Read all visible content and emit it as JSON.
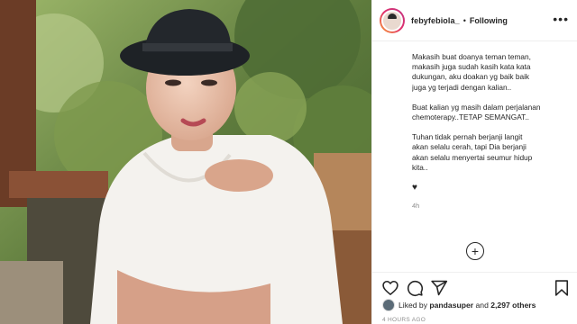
{
  "post": {
    "username": "febyfebiola_",
    "separator": "•",
    "follow_state": "Following",
    "more_label": "•••"
  },
  "caption": {
    "cut_line": "~~~~~ ~~~~~~~~ ~~~~~~~~~ ~~ ~~~~~~",
    "paragraph_1": "Makasih buat doanya teman teman,\nmakasih juga sudah kasih kata kata\ndukungan, aku doakan yg baik baik\njuga yg terjadi dengan kalian..",
    "paragraph_2": "Buat kalian yg masih dalam perjalanan\nchemoterapy..TETAP SEMANGAT..",
    "paragraph_3": "Tuhan tidak pernah berjanji langit\nakan selalu cerah, tapi Dia berjanji\nakan selalu menyertai seumur hidup\nkita..",
    "heart": "♥",
    "time_small": "4h"
  },
  "load_more": {
    "label": "+"
  },
  "actions": {
    "like_icon": "heart-outline-icon",
    "comment_icon": "comment-icon",
    "share_icon": "paper-plane-icon",
    "save_icon": "bookmark-icon"
  },
  "likes": {
    "prefix": "Liked by ",
    "user": "pandasuper",
    "middle": " and ",
    "others": "2,297 others"
  },
  "timestamp": "4 HOURS AGO",
  "colors": {
    "avatar_ring": "#e1306c",
    "text": "#262626",
    "muted": "#8e8e8e",
    "border": "#efefef"
  }
}
